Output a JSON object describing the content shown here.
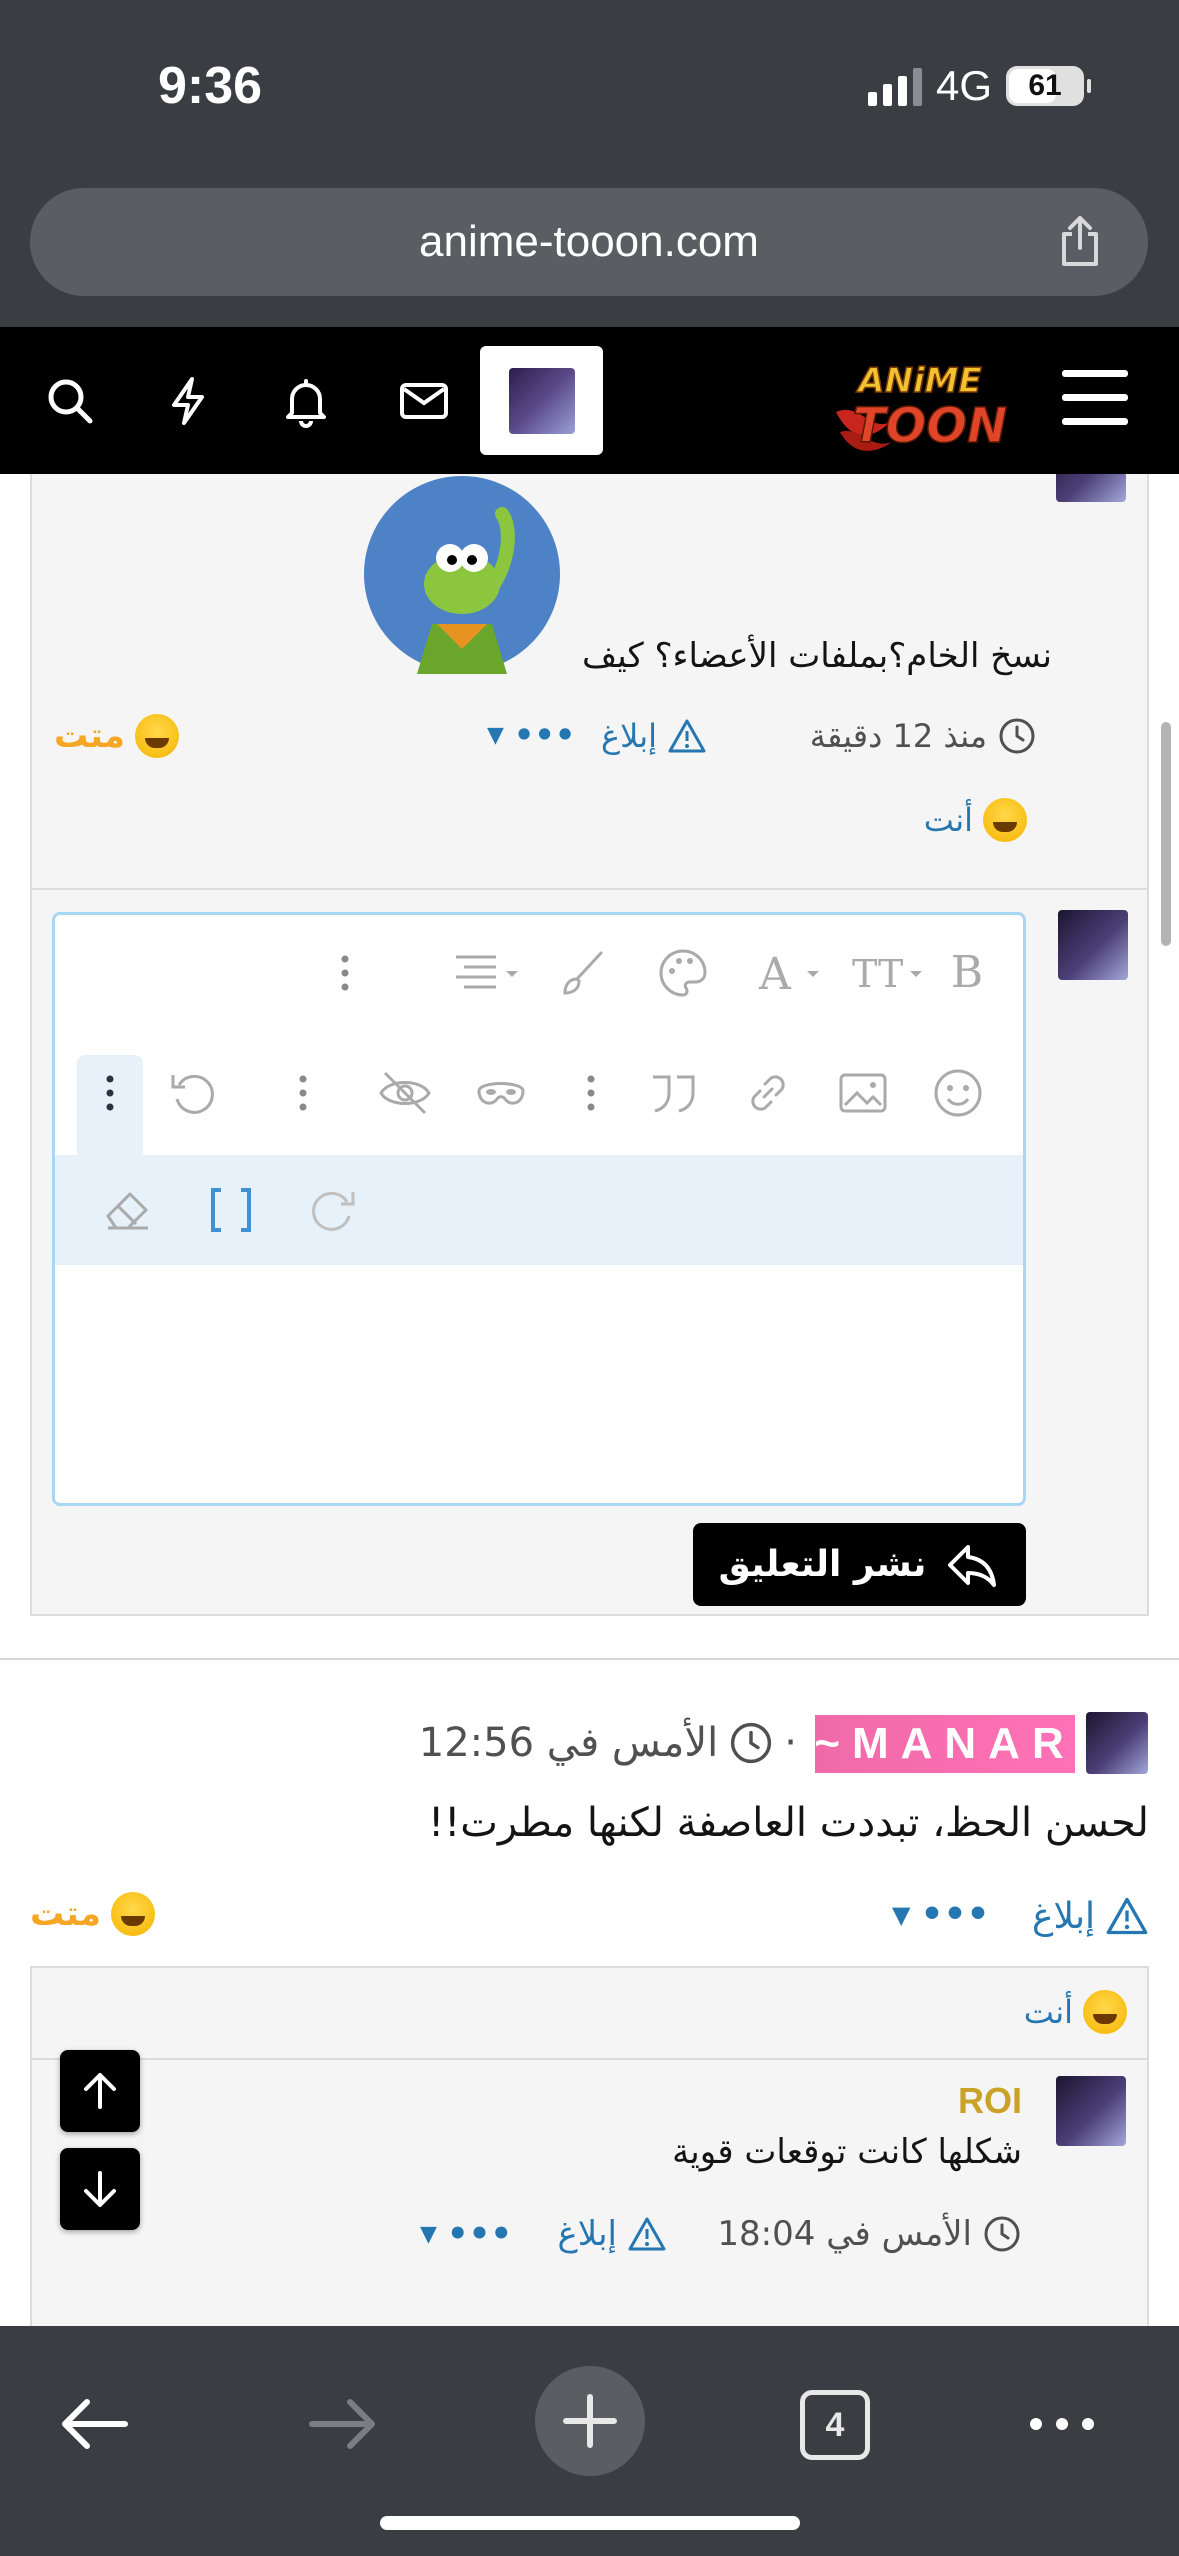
{
  "status_bar": {
    "time": "9:36",
    "network": "4G",
    "battery": "61"
  },
  "browser": {
    "url": "anime-tooon.com",
    "tab_count": "4"
  },
  "site_header": {
    "logo_top": "ANiME",
    "logo_bottom": "TOON"
  },
  "comment_top": {
    "text": "نسخ الخام؟بملفات الأعضاء؟ كيف",
    "time": "منذ 12 دقيقة",
    "report": "إبلاغ",
    "more": "•••",
    "reaction_count": "متت",
    "reacted_by": "أنت"
  },
  "reply_editor": {
    "post_button": "نشر التعليق"
  },
  "comment_manar": {
    "username": "~MANAR",
    "time": "الأمس في 12:56",
    "separator": "·",
    "text": "لحسن الحظ، تبددت العاصفة لكنها مطرت!!",
    "report": "إبلاغ",
    "more": "•••",
    "reaction_count": "متت",
    "reacted_by": "أنت"
  },
  "reply_roi": {
    "username": "ROI",
    "text": "شكلها كانت توقعات قوية",
    "time": "الأمس في 18:04",
    "report": "إبلاغ",
    "more": "•••"
  },
  "colors": {
    "accent": "#2577b1",
    "reaction": "#f5a623",
    "username_gold": "#c9a227",
    "badge_pink": "#f06aa8"
  }
}
